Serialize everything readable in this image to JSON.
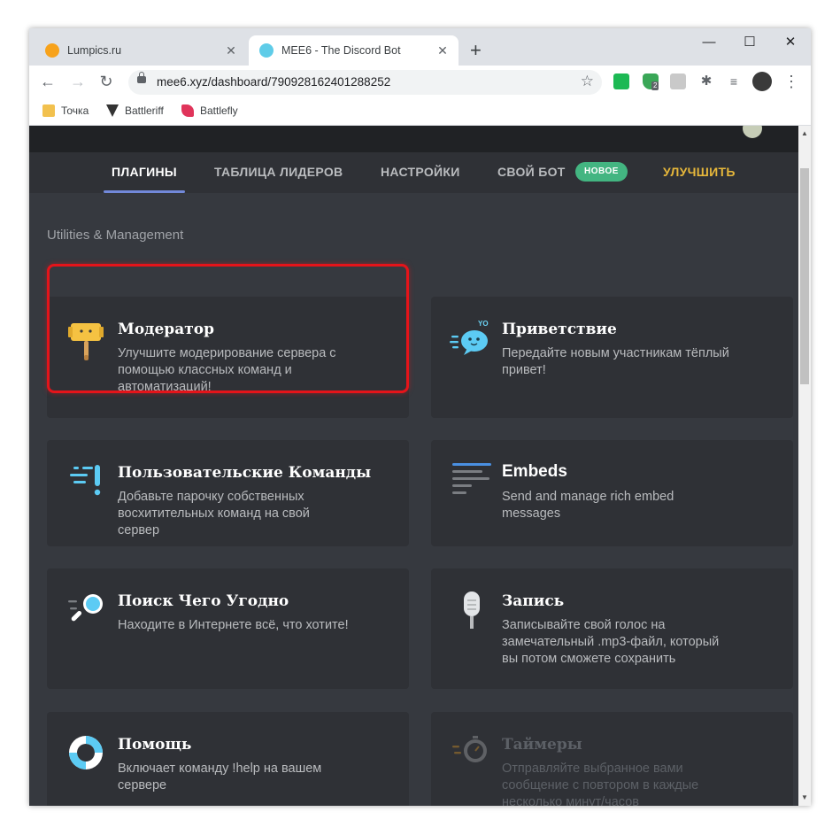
{
  "browser": {
    "tabs": [
      {
        "title": "Lumpics.ru",
        "active": false
      },
      {
        "title": "MEE6 - The Discord Bot",
        "active": true
      }
    ],
    "new_tab": "+",
    "window_controls": {
      "minimize": "—",
      "maximize": "☐",
      "close": "✕"
    },
    "nav": {
      "back": "←",
      "forward": "→",
      "reload": "↻"
    },
    "url": "mee6.xyz/dashboard/790928162401288252",
    "star": "☆",
    "extension_badge": "2",
    "menu": "⋮",
    "bookmarks": [
      {
        "label": "Точка",
        "icon": "folder-icon"
      },
      {
        "label": "Battleriff",
        "icon": "battleriff-icon"
      },
      {
        "label": "Battlefly",
        "icon": "battlefly-icon"
      }
    ]
  },
  "nav": {
    "plugins": "ПЛАГИНЫ",
    "leaderboard": "ТАБЛИЦА ЛИДЕРОВ",
    "settings": "НАСТРОЙКИ",
    "own_bot": "СВОЙ БОТ",
    "new_badge": "НОВОЕ",
    "upgrade": "УЛУЧШИТЬ"
  },
  "section_title": "Utilities & Management",
  "plugins": [
    {
      "title": "Модератор",
      "description": "Улучшите модерирование сервера с помощью классных команд и автоматизаций!",
      "icon": "hammer-icon",
      "highlighted": true
    },
    {
      "title": "Приветствие",
      "description": "Передайте новым участникам тёплый привет!",
      "icon": "welcome-bubble-icon"
    },
    {
      "title": "Пользовательские Команды",
      "description": "Добавьте парочку собственных восхитительных команд на свой сервер",
      "icon": "custom-commands-icon"
    },
    {
      "title": "Embeds",
      "description": "Send and manage rich embed messages",
      "icon": "embeds-icon"
    },
    {
      "title": "Поиск Чего Угодно",
      "description": "Находите в Интернете всё, что хотите!",
      "icon": "magnifier-icon"
    },
    {
      "title": "Запись",
      "description": "Записывайте свой голос на замечательный .mp3-файл, который вы потом сможете сохранить",
      "icon": "microphone-icon"
    },
    {
      "title": "Помощь",
      "description": "Включает команду !help на вашем сервере",
      "icon": "lifebuoy-icon"
    },
    {
      "title": "Таймеры",
      "description": "Отправляйте выбранное вами сообщение с повтором в каждые несколько минут/часов",
      "icon": "timer-icon",
      "disabled": true
    }
  ],
  "welcome_yo": "YO",
  "colors": {
    "accent": "#7289da",
    "highlight": "#e5141a",
    "upgrade": "#e6b73b",
    "badge": "#43b581",
    "background": "#36393f",
    "card": "#2f3136"
  }
}
